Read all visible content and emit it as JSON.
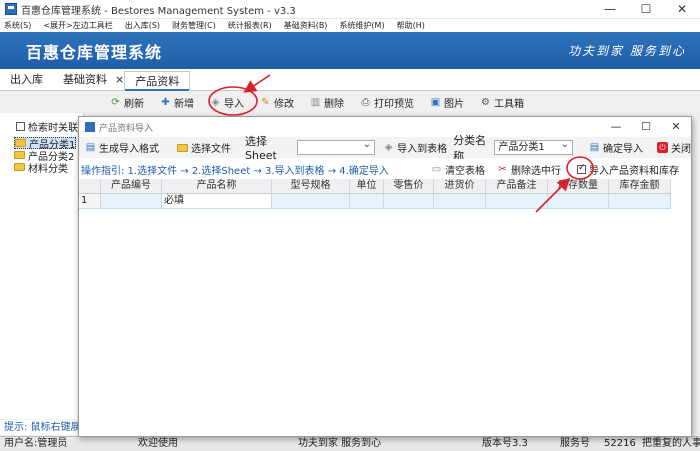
{
  "window": {
    "title": "百惠仓库管理系统 - Bestores Management System - v3.3",
    "controls": [
      "—",
      "☐",
      "✕"
    ]
  },
  "menu": [
    "系统(S)",
    "<展开>左边工具栏",
    "出入库(S)",
    "财务管理(C)",
    "统计报表(R)",
    "基础资料(B)",
    "系统维护(M)",
    "帮助(H)"
  ],
  "banner": {
    "name": "百惠仓库管理系统",
    "slogan": "功夫到家  服务到心"
  },
  "tabs": [
    {
      "label": "出入库"
    },
    {
      "label": "基础资料"
    },
    {
      "label": "产品资料",
      "active": true,
      "close": "×"
    }
  ],
  "toolbar": {
    "items": [
      {
        "label": "刷新",
        "icon": "refresh-icon"
      },
      {
        "label": "新增",
        "icon": "plus-icon"
      },
      {
        "label": "导入",
        "icon": "import-icon"
      },
      {
        "label": "修改",
        "icon": "edit-icon"
      },
      {
        "label": "删除",
        "icon": "trash-icon"
      },
      {
        "label": "打印预览",
        "icon": "print-icon"
      },
      {
        "label": "图片",
        "icon": "image-icon"
      },
      {
        "label": "工具箱",
        "icon": "toolbox-icon"
      }
    ]
  },
  "left_panel": {
    "search_check_label": "检索时关联子",
    "tree": [
      "产品分类1",
      "产品分类2",
      "材料分类"
    ],
    "hint": "提示: 鼠标右键展开"
  },
  "dialog": {
    "title": "产品资料导入",
    "controls": [
      "—",
      "☐",
      "✕"
    ],
    "gen_format_label": "生成导入格式",
    "choose_file_label": "选择文件",
    "sheet_label": "选择Sheet",
    "sheet_value": "",
    "import_to_table_label": "导入到表格",
    "category_label": "分类名称",
    "category_value": "产品分类1",
    "confirm_label": "确定导入",
    "close_label": "关闭",
    "guide": "操作指引: 1.选择文件 → 2.选择Sheet → 3.导入到表格 → 4.确定导入",
    "clear_label": "清空表格",
    "delete_row_label": "删除选中行",
    "import_stock_label": "导入产品资料和库存",
    "import_stock_checked": true,
    "columns": [
      "产品编号",
      "产品名称",
      "型号规格",
      "单位",
      "零售价",
      "进货价",
      "产品备注",
      "库存数量",
      "库存金额"
    ],
    "rows": [
      {
        "row_no": "1",
        "cells": [
          "",
          "必填",
          "",
          "",
          "",
          "",
          "",
          "",
          ""
        ]
      }
    ]
  },
  "status": {
    "user": "用户名:管理员",
    "welcome": "欢迎使用",
    "slogan": "功夫到家 服务到心",
    "version": "版本号3.3",
    "service": "服务号",
    "service_no": "52216",
    "tail": "把重复的人事"
  },
  "colors": {
    "banner": "#1f5ea8",
    "accent": "#2f73bd",
    "annotation": "#d9202a"
  }
}
